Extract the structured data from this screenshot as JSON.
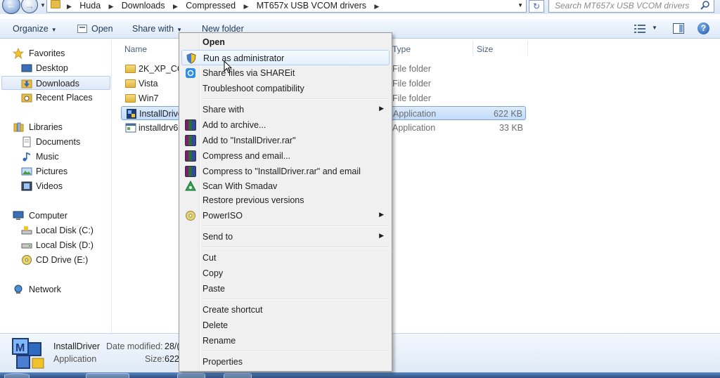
{
  "address": {
    "breadcrumbs": [
      "Huda",
      "Downloads",
      "Compressed",
      "MT657x USB VCOM drivers"
    ],
    "search_placeholder": "Search MT657x USB VCOM drivers"
  },
  "toolbar": {
    "organize": "Organize",
    "open": "Open",
    "share_with": "Share with",
    "new_folder": "New folder"
  },
  "sidebar": {
    "favorites": "Favorites",
    "favorites_items": [
      "Desktop",
      "Downloads",
      "Recent Places"
    ],
    "libraries": "Libraries",
    "libraries_items": [
      "Documents",
      "Music",
      "Pictures",
      "Videos"
    ],
    "computer": "Computer",
    "computer_items": [
      "Local Disk (C:)",
      "Local Disk (D:)",
      "CD Drive (E:)"
    ],
    "network": "Network"
  },
  "columns": {
    "name": "Name",
    "type": "Type",
    "size": "Size"
  },
  "files": [
    {
      "name": "2K_XP_CO",
      "type": "File folder",
      "size": ""
    },
    {
      "name": "Vista",
      "type": "File folder",
      "size": ""
    },
    {
      "name": "Win7",
      "type": "File folder",
      "size": ""
    },
    {
      "name": "InstallDrive",
      "type": "Application",
      "size": "622 KB"
    },
    {
      "name": "installdrv6",
      "type": "Application",
      "size": "33 KB"
    }
  ],
  "details": {
    "name": "InstallDriver",
    "type": "Application",
    "date_modified_label": "Date modified:",
    "date_modified_value": "28/(",
    "size_label": "Size:",
    "size_value": "622"
  },
  "context_menu": {
    "open": "Open",
    "run_as_admin": "Run as administrator",
    "share_shareit": "Share files via SHAREit",
    "troubleshoot": "Troubleshoot compatibility",
    "share_with": "Share with",
    "add_archive": "Add to archive...",
    "add_rar": "Add to \"InstallDriver.rar\"",
    "compress_email": "Compress and email...",
    "compress_rar_email": "Compress to \"InstallDriver.rar\" and email",
    "scan_smadav": "Scan With Smadav",
    "restore_versions": "Restore previous versions",
    "poweriso": "PowerISO",
    "send_to": "Send to",
    "cut": "Cut",
    "copy": "Copy",
    "paste": "Paste",
    "create_shortcut": "Create shortcut",
    "delete": "Delete",
    "rename": "Rename",
    "properties": "Properties"
  },
  "colors": {
    "selection": "#c1dbfc",
    "menu_hover": "#e3efff",
    "toolbar_text": "#1e395b"
  }
}
